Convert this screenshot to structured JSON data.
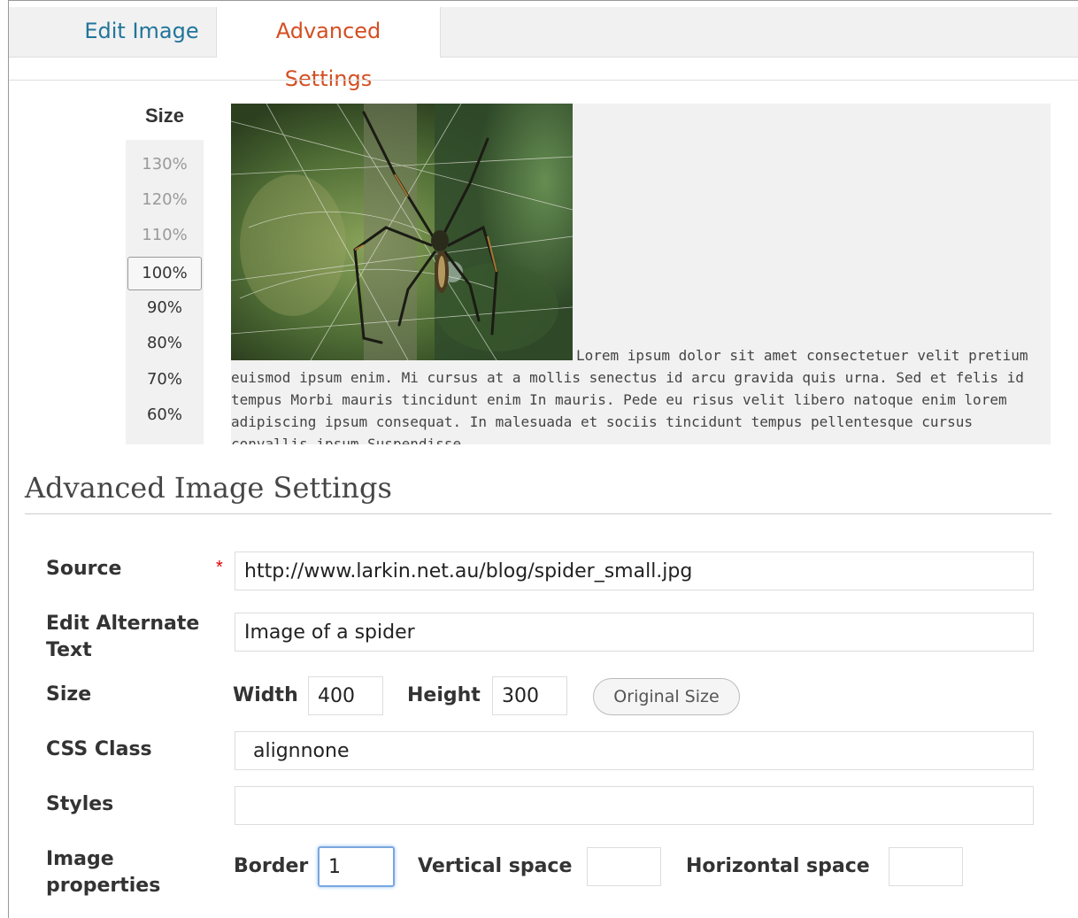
{
  "tabs": [
    {
      "label": "Edit Image"
    },
    {
      "label": "Advanced Settings"
    }
  ],
  "size_panel": {
    "title": "Size",
    "options": [
      "130%",
      "120%",
      "110%",
      "100%",
      "90%",
      "80%",
      "70%",
      "60%"
    ],
    "selected": "100%"
  },
  "preview": {
    "text": "Lorem ipsum dolor sit amet consectetuer velit pretium euismod ipsum enim. Mi cursus at a mollis senectus id arcu gravida quis urna. Sed et felis id tempus Morbi mauris tincidunt enim In mauris. Pede eu risus velit libero natoque enim lorem adipiscing ipsum consequat. In malesuada et sociis tincidunt tempus pellentesque cursus convallis ipsum Suspendisse."
  },
  "section": {
    "title": "Advanced Image Settings"
  },
  "form": {
    "source_label": "Source",
    "required_mark": "*",
    "source_value": "http://www.larkin.net.au/blog/spider_small.jpg",
    "alt_label": "Edit Alternate Text",
    "alt_value": "Image of a spider",
    "size_label": "Size",
    "width_label": "Width",
    "width_value": "400",
    "height_label": "Height",
    "height_value": "300",
    "original_size_button": "Original Size",
    "css_class_label": "CSS Class",
    "css_class_value": "alignnone",
    "styles_label": "Styles",
    "styles_value": "",
    "image_props_label": "Image properties",
    "border_label": "Border",
    "border_value": "1",
    "vspace_label": "Vertical space",
    "vspace_value": "",
    "hspace_label": "Horizontal space",
    "hspace_value": ""
  },
  "colors": {
    "tab_link": "#21759b",
    "tab_active": "#d54e21",
    "focus_ring": "#7aa7e0"
  }
}
